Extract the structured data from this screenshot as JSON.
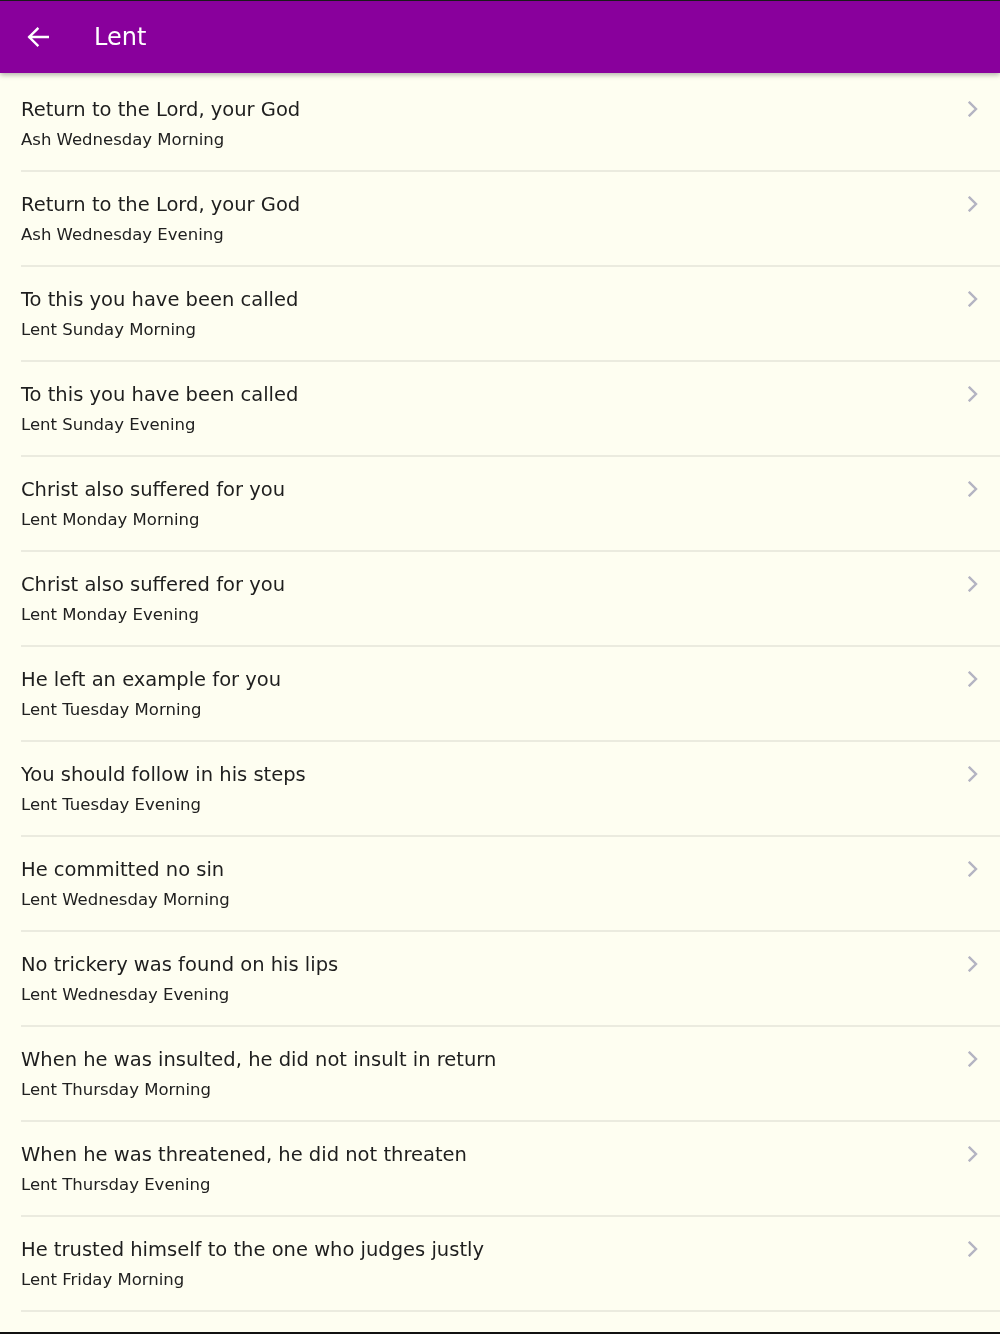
{
  "app_bar": {
    "title": "Lent"
  },
  "items": [
    {
      "title": "Return to the Lord, your God",
      "subtitle": "Ash Wednesday Morning"
    },
    {
      "title": "Return to the Lord, your God",
      "subtitle": "Ash Wednesday Evening"
    },
    {
      "title": "To this you have been called",
      "subtitle": "Lent Sunday Morning"
    },
    {
      "title": "To this you have been called",
      "subtitle": "Lent Sunday Evening"
    },
    {
      "title": "Christ also suffered for you",
      "subtitle": "Lent Monday Morning"
    },
    {
      "title": "Christ also suffered for you",
      "subtitle": "Lent Monday Evening"
    },
    {
      "title": "He left an example for you",
      "subtitle": "Lent Tuesday Morning"
    },
    {
      "title": "You should follow in his steps",
      "subtitle": "Lent Tuesday Evening"
    },
    {
      "title": "He committed no sin",
      "subtitle": "Lent Wednesday Morning"
    },
    {
      "title": "No trickery was found on his lips",
      "subtitle": "Lent Wednesday Evening"
    },
    {
      "title": "When he was insulted, he did not insult in return",
      "subtitle": "Lent Thursday Morning"
    },
    {
      "title": "When he was threatened, he did not threaten",
      "subtitle": "Lent Thursday Evening"
    },
    {
      "title": "He trusted himself to the one who judges justly",
      "subtitle": "Lent Friday Morning"
    }
  ]
}
